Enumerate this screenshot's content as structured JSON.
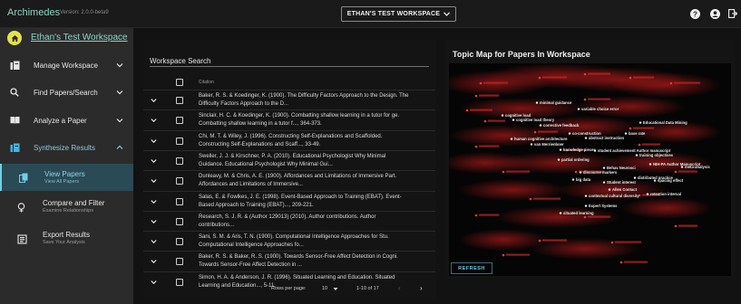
{
  "app": {
    "title": "Archimedes",
    "version": "Version: 2.0.0-beta9"
  },
  "workspace_select": {
    "label": "ETHAN'S TEST WORKSPACE"
  },
  "sidebar": {
    "workspace_name": "Ethan's Test Workspace",
    "items": [
      {
        "label": "Manage Workspace"
      },
      {
        "label": "Find Papers/Search"
      },
      {
        "label": "Analyze a Paper"
      },
      {
        "label": "Synthesize Results"
      }
    ],
    "sub_items": [
      {
        "label": "View Papers",
        "sub": "View All Papers"
      },
      {
        "label": "Compare and Filter",
        "sub": "Examine Relationships"
      },
      {
        "label": "Export Results",
        "sub": "Save Your Analysis"
      }
    ]
  },
  "table": {
    "search_label": "Workspace Search",
    "header_citation": "Citation",
    "rows": [
      {
        "line1": "Baker, R. S. & Koedinger, K. (1900). The Difficulty Factors Approach to the Design. The",
        "line2": "Difficulty Factors Approach to the D..."
      },
      {
        "line1": "Sinclair, H. C. & Koedinger, K. (1900). Combatting shallow learning in a tutor for ge.",
        "line2": "Combatting shallow learning in a tutor f..., 364-373."
      },
      {
        "line1": "Chi, M. T. & Wiley, J. (1996). Constructing Self-Explanations and Scaffolded.",
        "line2": "Constructing Self-Explanations and Scaff..., 33-49."
      },
      {
        "line1": "Sweller, J. J. & Kirschner, P. A. (2010). Educational Psychologist Why Minimal",
        "line2": "Guidance. Educational Psychologist Why Minimal Gui..."
      },
      {
        "line1": "Dunleavy, M. & Chris, A. E. (1900). Affordances and Limitations of Immersive Part.",
        "line2": "Affordances and Limitations of Immersive..."
      },
      {
        "line1": "Salas, E. & Fowlkes, J. E. (1998). Event-Based Approach to Training (EBAT). Event-",
        "line2": "Based Approach to Training (EBAT)..., 209-221."
      },
      {
        "line1": "Research, S. J. R. & (Author 129013) (2010). Author contributions. Author",
        "line2": "contributions..."
      },
      {
        "line1": "Sani, S. M. & Aris, T. N. (1900). Computational Intelligence Approaches for Stu.",
        "line2": "Computational Intelligence Approaches fo..."
      },
      {
        "line1": "Baker, R. S. & Baker, R. S. (1900). Towards Sensor-Free Affect Detection in Cogni.",
        "line2": "Towards Sensor-Free Affect Detection in ..."
      },
      {
        "line1": "Simon, H. A. & Anderson, J. R. (1996). Situated Learning and Education. Situated",
        "line2": "Learning and Education..., 5-11."
      }
    ],
    "pager": {
      "rows_per_page_label": "Rows per page:",
      "rows_per_page": "10",
      "range": "1-10 of 17"
    }
  },
  "topic_map": {
    "title": "Topic Map for Papers In Workspace",
    "refresh_label": "REFRESH",
    "white_labels": [
      "minimal guidance",
      "variable choice error",
      "cognitive load",
      "cognitive load theory",
      "corrective feedback",
      "Educational Data Mining",
      "co-construction",
      "base rate",
      "human cognitive architecture",
      "abstract instruction",
      "van Merrienboer",
      "knowledge pieces",
      "student achievement Author manuscript",
      "training objectives",
      "partial ordering",
      "NIH-PA Author Manuscript",
      "Behav Neurosci",
      "meta-analysis",
      "discourse markers",
      "distributed practice",
      "big data",
      "Student interest",
      "spacing effect",
      "Allen Contact",
      "contextual cultural diversity",
      "retention interval",
      "Expert Systems",
      "situated learning"
    ]
  },
  "colors": {
    "accent": "#8fd4c4",
    "map_highlight": "#d92a2a",
    "active_nav": "#2a4a55"
  }
}
